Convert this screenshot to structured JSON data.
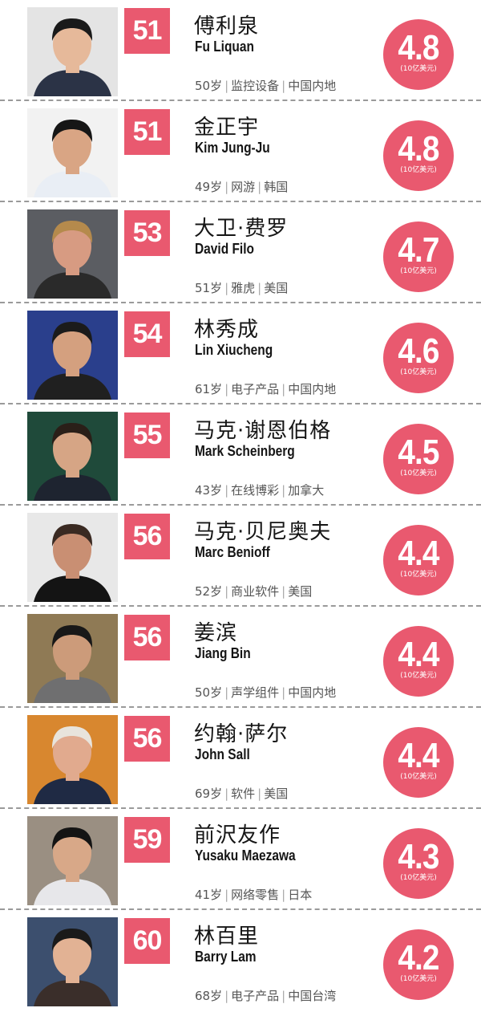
{
  "people": [
    {
      "rank": "51",
      "name_cn": "傅利泉",
      "name_en": "Fu Liquan",
      "age": "50岁",
      "industry": "监控设备",
      "region": "中国内地",
      "worth": "4.8",
      "unit": "(10亿美元)",
      "bg": "#e4e4e4",
      "skin": "#e6b99a",
      "hair": "#1a1a1a",
      "shirt": "#2b3346"
    },
    {
      "rank": "51",
      "name_cn": "金正宇",
      "name_en": "Kim Jung-Ju",
      "age": "49岁",
      "industry": "网游",
      "region": "韩国",
      "worth": "4.8",
      "unit": "(10亿美元)",
      "bg": "#f2f2f2",
      "skin": "#d9a584",
      "hair": "#161616",
      "shirt": "#e9eef5"
    },
    {
      "rank": "53",
      "name_cn": "大卫·费罗",
      "name_en": "David Filo",
      "age": "51岁",
      "industry": "雅虎",
      "region": "美国",
      "worth": "4.7",
      "unit": "(10亿美元)",
      "bg": "#5b5d62",
      "skin": "#d79b82",
      "hair": "#b58a4c",
      "shirt": "#2a2a2a"
    },
    {
      "rank": "54",
      "name_cn": "林秀成",
      "name_en": "Lin Xiucheng",
      "age": "61岁",
      "industry": "电子产品",
      "region": "中国内地",
      "worth": "4.6",
      "unit": "(10亿美元)",
      "bg": "#2a3f8c",
      "skin": "#d4a07f",
      "hair": "#1b1b1b",
      "shirt": "#202020"
    },
    {
      "rank": "55",
      "name_cn": "马克·谢恩伯格",
      "name_en": "Mark Scheinberg",
      "age": "43岁",
      "industry": "在线博彩",
      "region": "加拿大",
      "worth": "4.5",
      "unit": "(10亿美元)",
      "bg": "#1f4a3a",
      "skin": "#d6a585",
      "hair": "#2a1f18",
      "shirt": "#1e2430"
    },
    {
      "rank": "56",
      "name_cn": "马克·贝尼奥夫",
      "name_en": "Marc Benioff",
      "age": "52岁",
      "industry": "商业软件",
      "region": "美国",
      "worth": "4.4",
      "unit": "(10亿美元)",
      "bg": "#e8e8e8",
      "skin": "#c98f73",
      "hair": "#3a2a22",
      "shirt": "#141414"
    },
    {
      "rank": "56",
      "name_cn": "姜滨",
      "name_en": "Jiang Bin",
      "age": "50岁",
      "industry": "声学组件",
      "region": "中国内地",
      "worth": "4.4",
      "unit": "(10亿美元)",
      "bg": "#8f7a55",
      "skin": "#cc9b7a",
      "hair": "#181818",
      "shirt": "#6f6f70"
    },
    {
      "rank": "56",
      "name_cn": "约翰·萨尔",
      "name_en": "John Sall",
      "age": "69岁",
      "industry": "软件",
      "region": "美国",
      "worth": "4.4",
      "unit": "(10亿美元)",
      "bg": "#d8872f",
      "skin": "#e1aa8e",
      "hair": "#e8e4dc",
      "shirt": "#1f2a44"
    },
    {
      "rank": "59",
      "name_cn": "前沢友作",
      "name_en": "Yusaku Maezawa",
      "age": "41岁",
      "industry": "网络零售",
      "region": "日本",
      "worth": "4.3",
      "unit": "(10亿美元)",
      "bg": "#9a8f82",
      "skin": "#d8a888",
      "hair": "#141414",
      "shirt": "#e7e7ea"
    },
    {
      "rank": "60",
      "name_cn": "林百里",
      "name_en": "Barry Lam",
      "age": "68岁",
      "industry": "电子产品",
      "region": "中国台湾",
      "worth": "4.2",
      "unit": "(10亿美元)",
      "bg": "#3c4f6e",
      "skin": "#e2b294",
      "hair": "#1a1a1a",
      "shirt": "#3a2e2a"
    }
  ]
}
